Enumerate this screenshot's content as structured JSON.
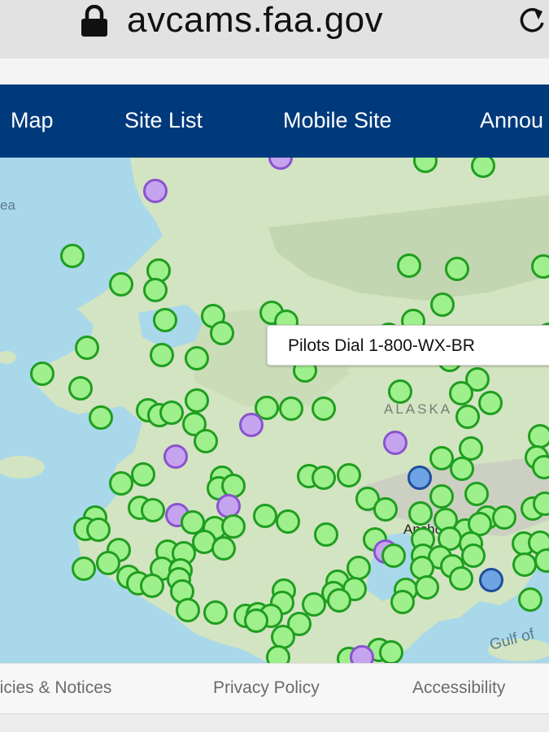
{
  "browser": {
    "url": "avcams.faa.gov",
    "lock_icon": "lock-icon",
    "reload_icon": "reload-icon"
  },
  "nav": {
    "items": [
      {
        "label": "Map"
      },
      {
        "label": "Site List"
      },
      {
        "label": "Mobile Site"
      },
      {
        "label": "Annou"
      }
    ]
  },
  "map": {
    "banner": "Pilots Dial 1-800-WX-BR",
    "labels": {
      "sea": "ea",
      "alaska": "ALASKA",
      "anchorage": "Anchorage",
      "gulf": "Gulf of"
    },
    "colors": {
      "water": "#a8d8ea",
      "land": "#cfe3bf",
      "camera_site_fill": "#9ef08c",
      "camera_site_stroke": "#1f9e1f",
      "purple_site_fill": "#c6a3ef",
      "purple_site_stroke": "#8a53cf",
      "blue_site_fill": "#6fa4e4",
      "blue_site_stroke": "#1f4f9a"
    }
  },
  "footer": {
    "links": [
      {
        "label": "licies & Notices"
      },
      {
        "label": "Privacy Policy"
      },
      {
        "label": "Accessibility"
      }
    ]
  }
}
